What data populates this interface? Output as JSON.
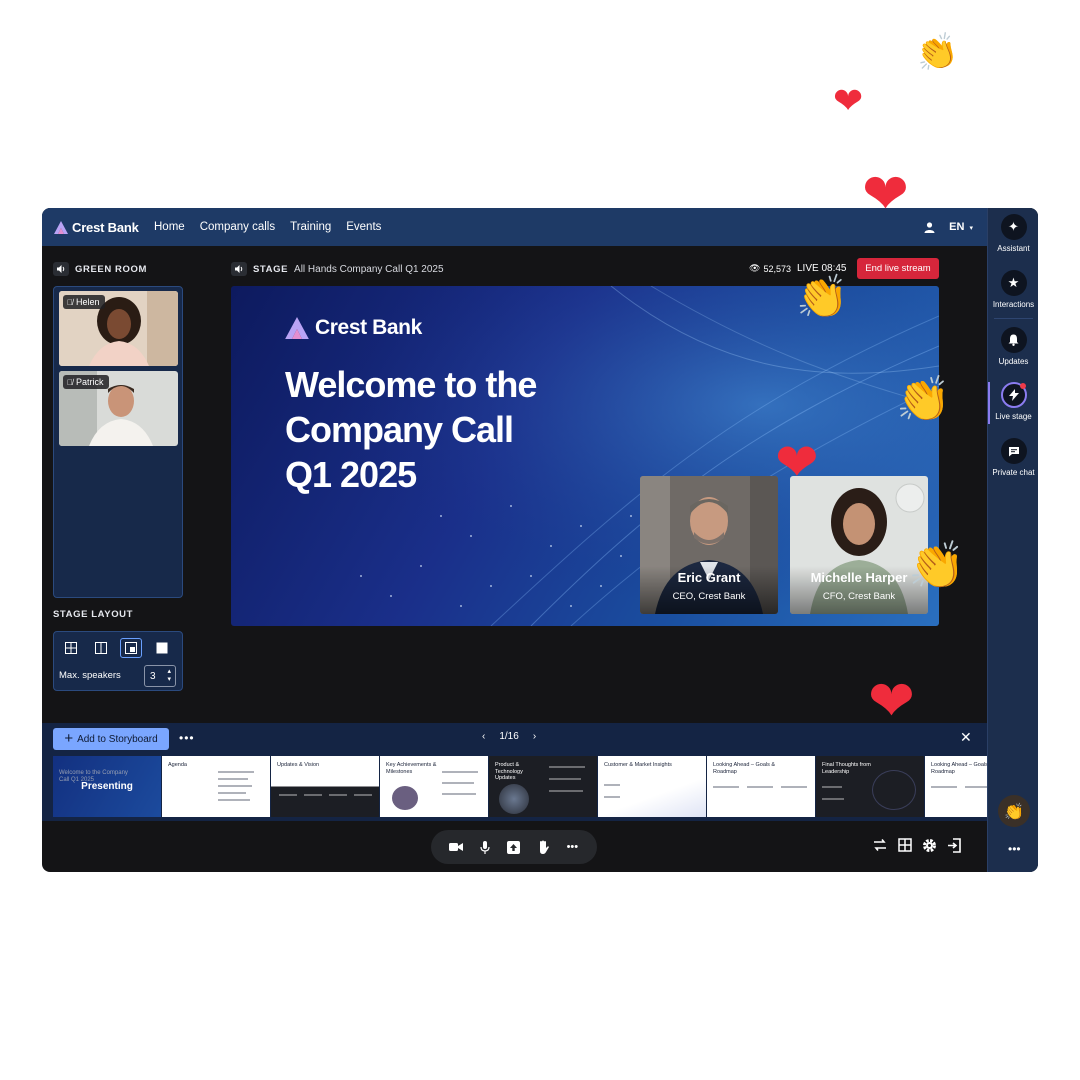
{
  "brand": {
    "name": "Crest Bank"
  },
  "nav": {
    "items": [
      "Home",
      "Company calls",
      "Training",
      "Events"
    ]
  },
  "topbar": {
    "language": "EN"
  },
  "sidebar": {
    "items": [
      {
        "label": "Assistant",
        "icon": "sparkle-icon"
      },
      {
        "label": "Interactions",
        "icon": "star-icon"
      },
      {
        "label": "Updates",
        "icon": "bell-icon"
      },
      {
        "label": "Live stage",
        "icon": "bolt-icon"
      },
      {
        "label": "Private chat",
        "icon": "chat-icon"
      }
    ]
  },
  "green_room": {
    "title": "GREEN ROOM",
    "participants": [
      {
        "name": "Helen",
        "muted": true
      },
      {
        "name": "Patrick",
        "muted": true
      }
    ]
  },
  "stage_layout": {
    "title": "STAGE LAYOUT",
    "max_speakers_label": "Max. speakers",
    "max_speakers_value": "3",
    "selected_layout": 3
  },
  "stage": {
    "label": "STAGE",
    "title": "All Hands Company Call Q1 2025",
    "viewers": "52,573",
    "live_time": "LIVE 08:45",
    "end_button": "End live stream",
    "slide": {
      "brand": "Crest Bank",
      "headline": [
        "Welcome to the",
        "Company Call",
        "Q1 2025"
      ]
    },
    "speakers": [
      {
        "name": "Eric Grant",
        "role": "CEO, Crest Bank"
      },
      {
        "name": "Michelle Harper",
        "role": "CFO, Crest Bank"
      }
    ]
  },
  "storyboard": {
    "add_label": "Add to Storyboard",
    "page": "1/16",
    "presenting_label": "Presenting",
    "thumbnails": [
      {
        "title": "Welcome to the Company Call Q1 2025",
        "theme": "blue"
      },
      {
        "title": "Agenda",
        "theme": "light"
      },
      {
        "title": "Updates & Vision",
        "theme": "light-dark"
      },
      {
        "title": "Key Achievements & Milestones",
        "theme": "light"
      },
      {
        "title": "Product & Technology Updates",
        "theme": "dark"
      },
      {
        "title": "Customer & Market Insights",
        "theme": "light"
      },
      {
        "title": "Looking Ahead – Goals & Roadmap",
        "theme": "light"
      },
      {
        "title": "Final Thoughts from Leadership",
        "theme": "dark"
      },
      {
        "title": "Looking Ahead – Goals & Roadmap",
        "theme": "light"
      }
    ]
  },
  "colors": {
    "topbar": "#1e3a66",
    "end_button": "#d6263b",
    "accent": "#7aa6ff",
    "active": "#8b7cf0"
  }
}
